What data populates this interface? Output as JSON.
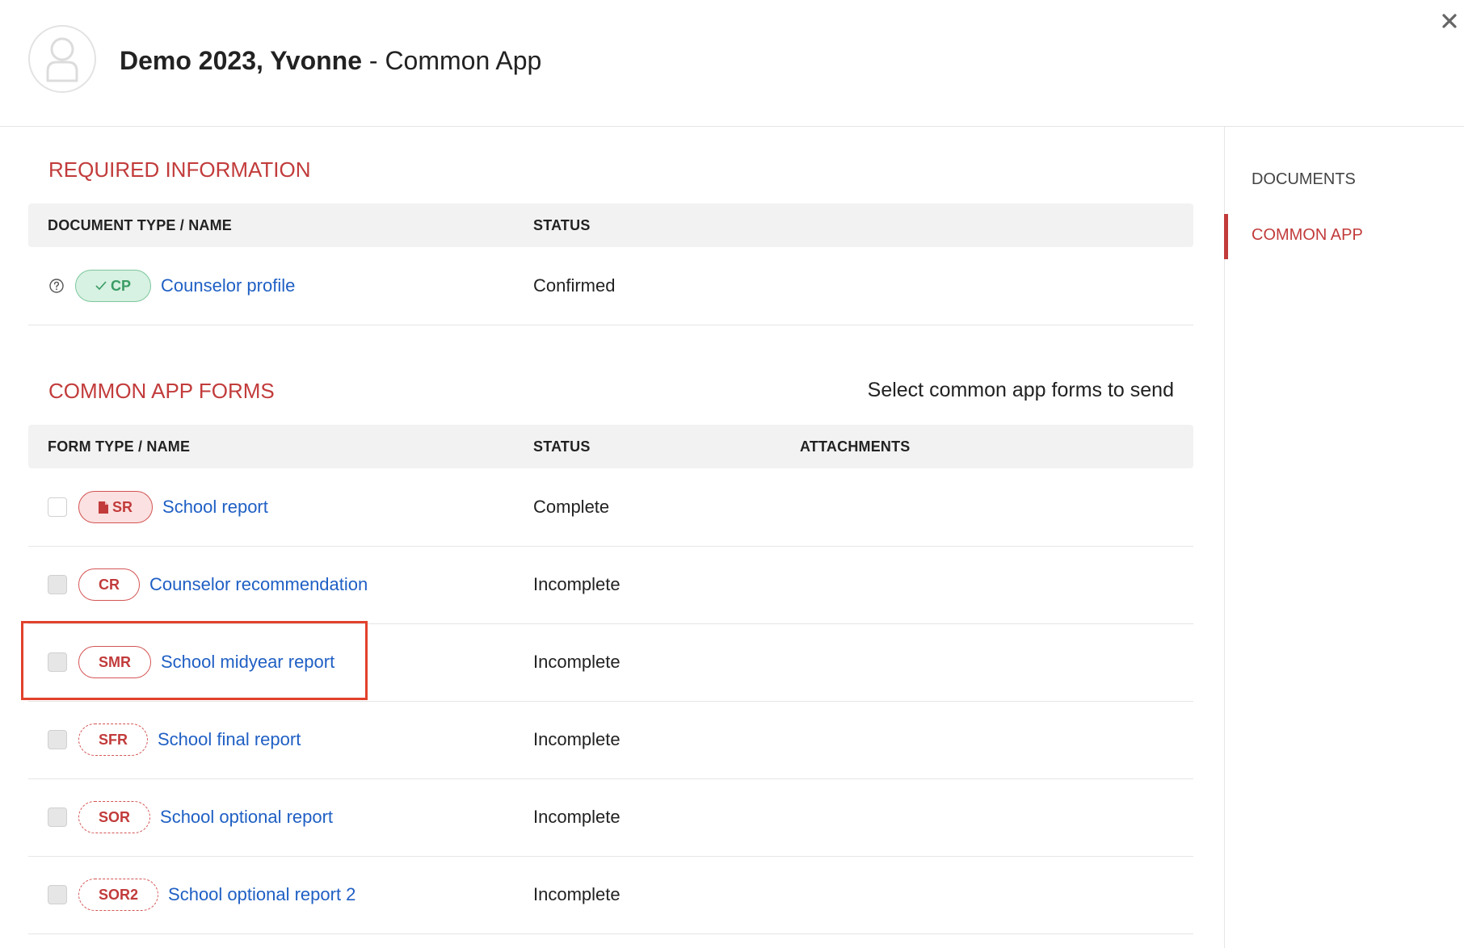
{
  "header": {
    "student_name": "Demo 2023, Yvonne",
    "separator": " - ",
    "context": "Common App"
  },
  "sidebar": {
    "items": [
      {
        "label": "DOCUMENTS"
      },
      {
        "label": "COMMON APP"
      }
    ],
    "active_index": 1
  },
  "required": {
    "title": "REQUIRED INFORMATION",
    "col_name": "DOCUMENT TYPE / NAME",
    "col_status": "STATUS",
    "rows": [
      {
        "badge": "CP",
        "name": "Counselor profile",
        "status": "Confirmed"
      }
    ]
  },
  "forms": {
    "title": "COMMON APP FORMS",
    "select_text": "Select common app forms to send",
    "col_name": "FORM TYPE / NAME",
    "col_status": "STATUS",
    "col_attachments": "ATTACHMENTS",
    "rows": [
      {
        "badge": "SR",
        "name": "School report",
        "status": "Complete"
      },
      {
        "badge": "CR",
        "name": "Counselor recommendation",
        "status": "Incomplete"
      },
      {
        "badge": "SMR",
        "name": "School midyear report",
        "status": "Incomplete"
      },
      {
        "badge": "SFR",
        "name": "School final report",
        "status": "Incomplete"
      },
      {
        "badge": "SOR",
        "name": "School optional report",
        "status": "Incomplete"
      },
      {
        "badge": "SOR2",
        "name": "School optional report 2",
        "status": "Incomplete"
      }
    ]
  },
  "colors": {
    "accent_red": "#c23b3b",
    "link_blue": "#1f5fc4",
    "confirmed_green": "#3a9c64",
    "highlight_red": "#e2412c"
  }
}
